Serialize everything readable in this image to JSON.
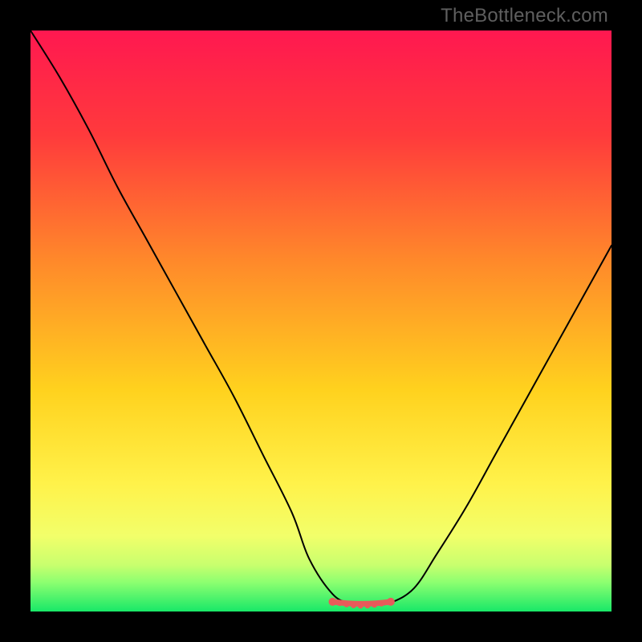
{
  "watermark": {
    "text": "TheBottleneck.com"
  },
  "colors": {
    "background": "#000000",
    "curve": "#000000",
    "optimal_stroke": "#e85a5a",
    "optimal_dot": "#e85a5a",
    "gradient_stops": [
      {
        "pct": 0,
        "color": "#ff1850"
      },
      {
        "pct": 18,
        "color": "#ff3a3c"
      },
      {
        "pct": 40,
        "color": "#ff8a2a"
      },
      {
        "pct": 62,
        "color": "#ffd21e"
      },
      {
        "pct": 78,
        "color": "#fff24a"
      },
      {
        "pct": 87,
        "color": "#f2ff6a"
      },
      {
        "pct": 92,
        "color": "#c8ff6e"
      },
      {
        "pct": 95,
        "color": "#8cff70"
      },
      {
        "pct": 100,
        "color": "#18e868"
      }
    ]
  },
  "chart_data": {
    "type": "line",
    "title": "",
    "xlabel": "",
    "ylabel": "",
    "xlim": [
      0,
      100
    ],
    "ylim": [
      0,
      100
    ],
    "grid": false,
    "legend": false,
    "series": [
      {
        "name": "bottleneck-curve",
        "x": [
          0,
          5,
          10,
          15,
          20,
          25,
          30,
          35,
          40,
          45,
          48,
          52,
          55,
          58,
          60,
          62,
          66,
          70,
          75,
          80,
          85,
          90,
          95,
          100
        ],
        "values": [
          100,
          92,
          83,
          73,
          64,
          55,
          46,
          37,
          27,
          17,
          9,
          3,
          1.5,
          1.3,
          1.3,
          1.5,
          4,
          10,
          18,
          27,
          36,
          45,
          54,
          63
        ]
      }
    ],
    "optimal_range": {
      "x_start": 52,
      "x_end": 62,
      "y": 1.4,
      "dots_x": [
        52,
        53.2,
        54.4,
        55.6,
        56.8,
        58,
        59.2,
        60.4,
        61.6,
        62
      ]
    }
  }
}
